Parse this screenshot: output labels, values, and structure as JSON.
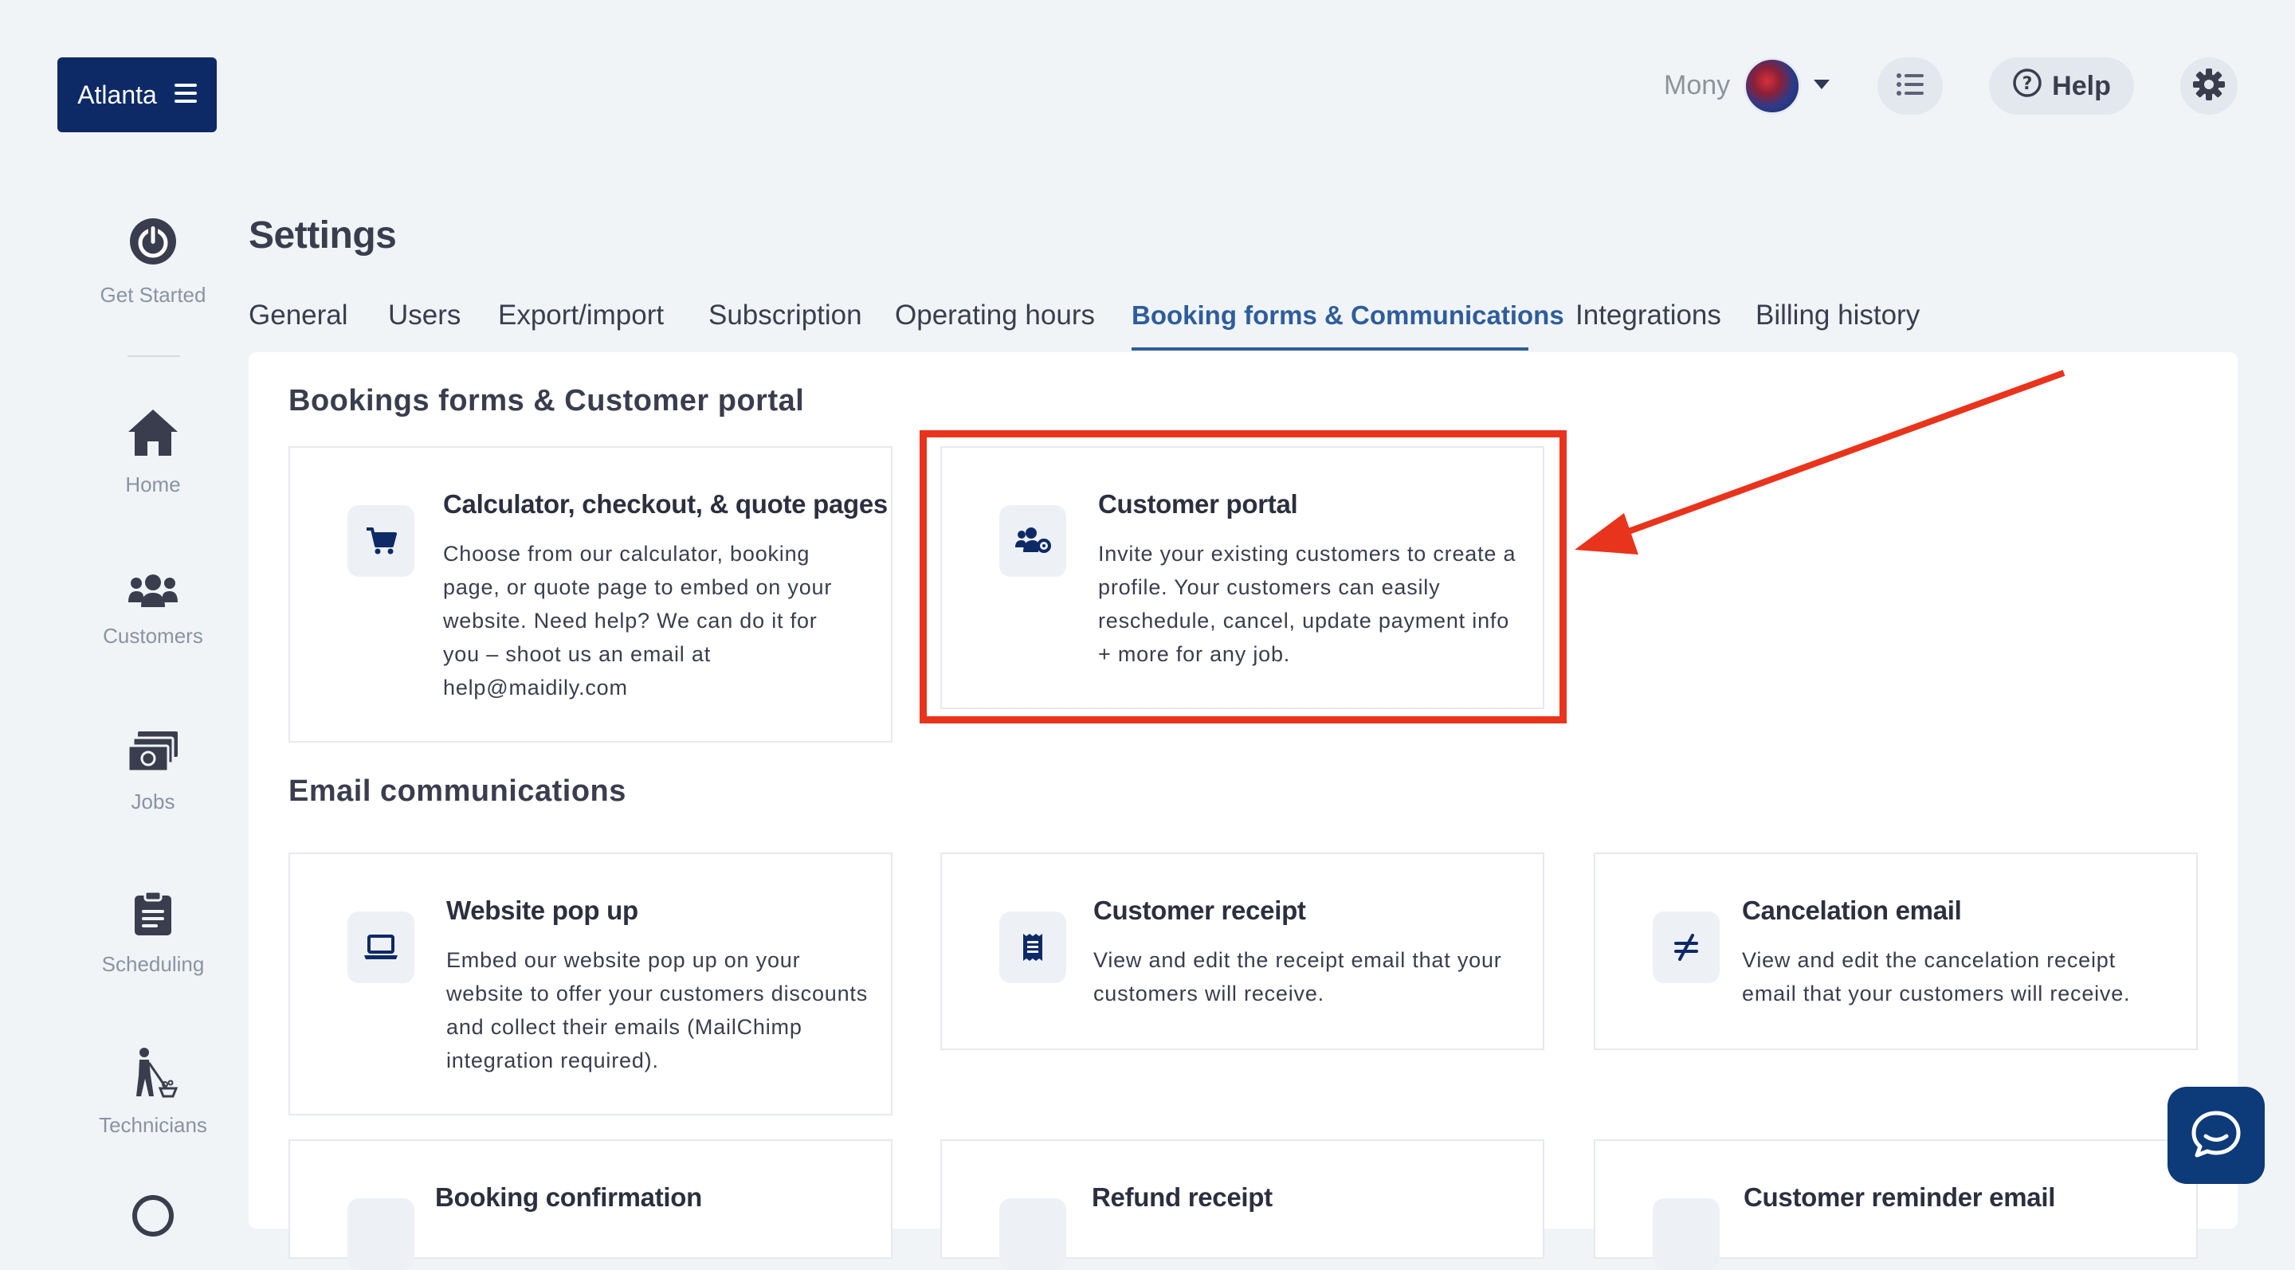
{
  "topbar": {
    "location": "Atlanta",
    "user_name": "Mony",
    "help_label": "Help"
  },
  "sidebar": {
    "items": [
      {
        "label": "Get Started",
        "icon": "power-icon"
      },
      {
        "label": "Home",
        "icon": "home-icon"
      },
      {
        "label": "Customers",
        "icon": "users-icon"
      },
      {
        "label": "Jobs",
        "icon": "money-icon"
      },
      {
        "label": "Scheduling",
        "icon": "clipboard-icon"
      },
      {
        "label": "Technicians",
        "icon": "cleaner-icon"
      }
    ]
  },
  "page": {
    "title": "Settings",
    "tabs": [
      "General",
      "Users",
      "Export/import",
      "Subscription",
      "Operating hours",
      "Booking forms & Communications",
      "Integrations",
      "Billing history"
    ],
    "active_tab": "Booking forms & Communications"
  },
  "sections": {
    "booking": {
      "title": "Bookings forms & Customer portal",
      "cards": [
        {
          "title": "Calculator, checkout, & quote pages",
          "lines": [
            "Choose from our calculator, booking",
            "page, or quote page to embed on your",
            "website. Need help? We can do it for",
            "you – shoot us an email at",
            "help@maidily.com"
          ]
        },
        {
          "title": "Customer portal",
          "lines": [
            "Invite your existing customers to create a",
            "profile. Your customers can easily",
            "reschedule, cancel, update payment info",
            "+ more for any job."
          ]
        }
      ]
    },
    "email": {
      "title": "Email communications",
      "cards": [
        {
          "title": "Website pop up",
          "lines": [
            "Embed our website pop up on your",
            "website to offer your customers discounts",
            "and collect their emails (MailChimp",
            "integration required)."
          ]
        },
        {
          "title": "Customer receipt",
          "lines": [
            "View and edit the receipt email that your",
            "customers will receive."
          ]
        },
        {
          "title": "Cancelation email",
          "lines": [
            "View and edit the cancelation receipt",
            "email that your customers will receive."
          ]
        },
        {
          "title": "Booking confirmation"
        },
        {
          "title": "Refund receipt"
        },
        {
          "title": "Customer reminder email"
        }
      ]
    }
  },
  "colors": {
    "brand_navy": "#0d2a66",
    "active_tab": "#2e5d9c",
    "annotation_red": "#e8341c",
    "background": "#f1f4f7"
  }
}
